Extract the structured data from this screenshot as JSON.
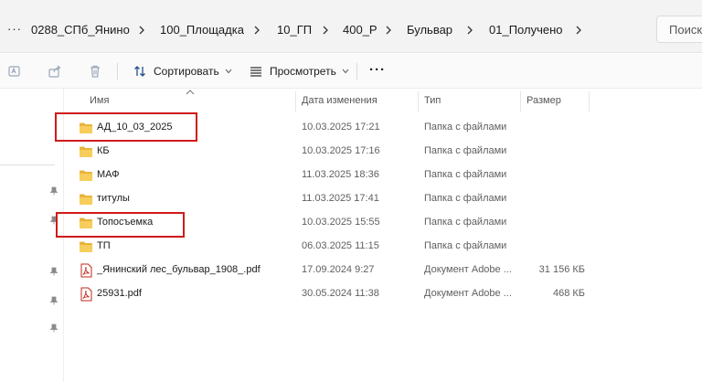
{
  "breadcrumbs": {
    "more": "···",
    "items": [
      {
        "label": "0288_СПб_Янино"
      },
      {
        "label": "100_Площадка"
      },
      {
        "label": "10_ГП"
      },
      {
        "label": "400_Р"
      },
      {
        "label": "Бульвар"
      },
      {
        "label": "01_Получено"
      }
    ]
  },
  "search": {
    "label": "Поиск"
  },
  "toolbar": {
    "sort_label": "Сортировать",
    "view_label": "Просмотреть",
    "more_label": "···"
  },
  "columns": {
    "name": "Имя",
    "date": "Дата изменения",
    "type": "Тип",
    "size": "Размер"
  },
  "files": [
    {
      "name": "АД_10_03_2025",
      "date": "10.03.2025 17:21",
      "type": "Папка с файлами",
      "size": "",
      "icon": "folder-icon"
    },
    {
      "name": "КБ",
      "date": "10.03.2025 17:16",
      "type": "Папка с файлами",
      "size": "",
      "icon": "folder-icon"
    },
    {
      "name": "МАФ",
      "date": "11.03.2025 18:36",
      "type": "Папка с файлами",
      "size": "",
      "icon": "folder-icon"
    },
    {
      "name": "титулы",
      "date": "11.03.2025 17:41",
      "type": "Папка с файлами",
      "size": "",
      "icon": "folder-icon"
    },
    {
      "name": "Топосъемка",
      "date": "10.03.2025 15:55",
      "type": "Папка с файлами",
      "size": "",
      "icon": "folder-icon"
    },
    {
      "name": "ТП",
      "date": "06.03.2025 11:15",
      "type": "Папка с файлами",
      "size": "",
      "icon": "folder-icon"
    },
    {
      "name": "_Янинский лес_бульвар_1908_.pdf",
      "date": "17.09.2024 9:27",
      "type": "Документ Adobe ...",
      "size": "31 156 КБ",
      "icon": "pdf-icon"
    },
    {
      "name": "25931.pdf",
      "date": "30.05.2024 11:38",
      "type": "Документ Adobe ...",
      "size": "468 КБ",
      "icon": "pdf-icon"
    }
  ],
  "colors": {
    "folder": "#f2c14e",
    "highlight": "#d11a1a",
    "pdf": "#c0281e"
  }
}
